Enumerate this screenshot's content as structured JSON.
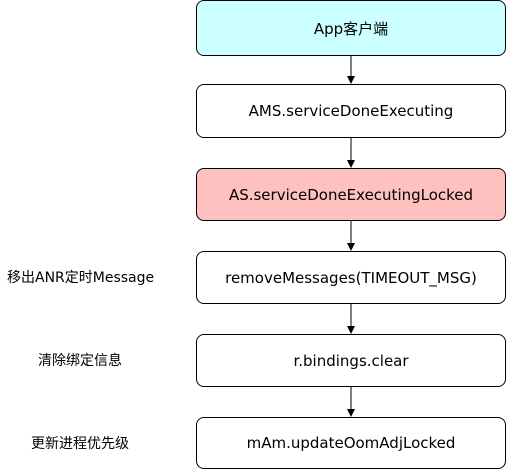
{
  "nodes": [
    {
      "label": "App客户端",
      "fill": "#ccffff"
    },
    {
      "label": "AMS.serviceDoneExecuting",
      "fill": "#ffffff"
    },
    {
      "label": "AS.serviceDoneExecutingLocked",
      "fill": "#ffc0c0"
    },
    {
      "label": "removeMessages(TIMEOUT_MSG)",
      "fill": "#ffffff"
    },
    {
      "label": "r.bindings.clear",
      "fill": "#ffffff"
    },
    {
      "label": "mAm.updateOomAdjLocked",
      "fill": "#ffffff"
    }
  ],
  "notes": {
    "remove_messages": "移出ANR定时Message",
    "bindings_clear": "清除绑定信息",
    "update_oom_adj": "更新进程优先级"
  }
}
